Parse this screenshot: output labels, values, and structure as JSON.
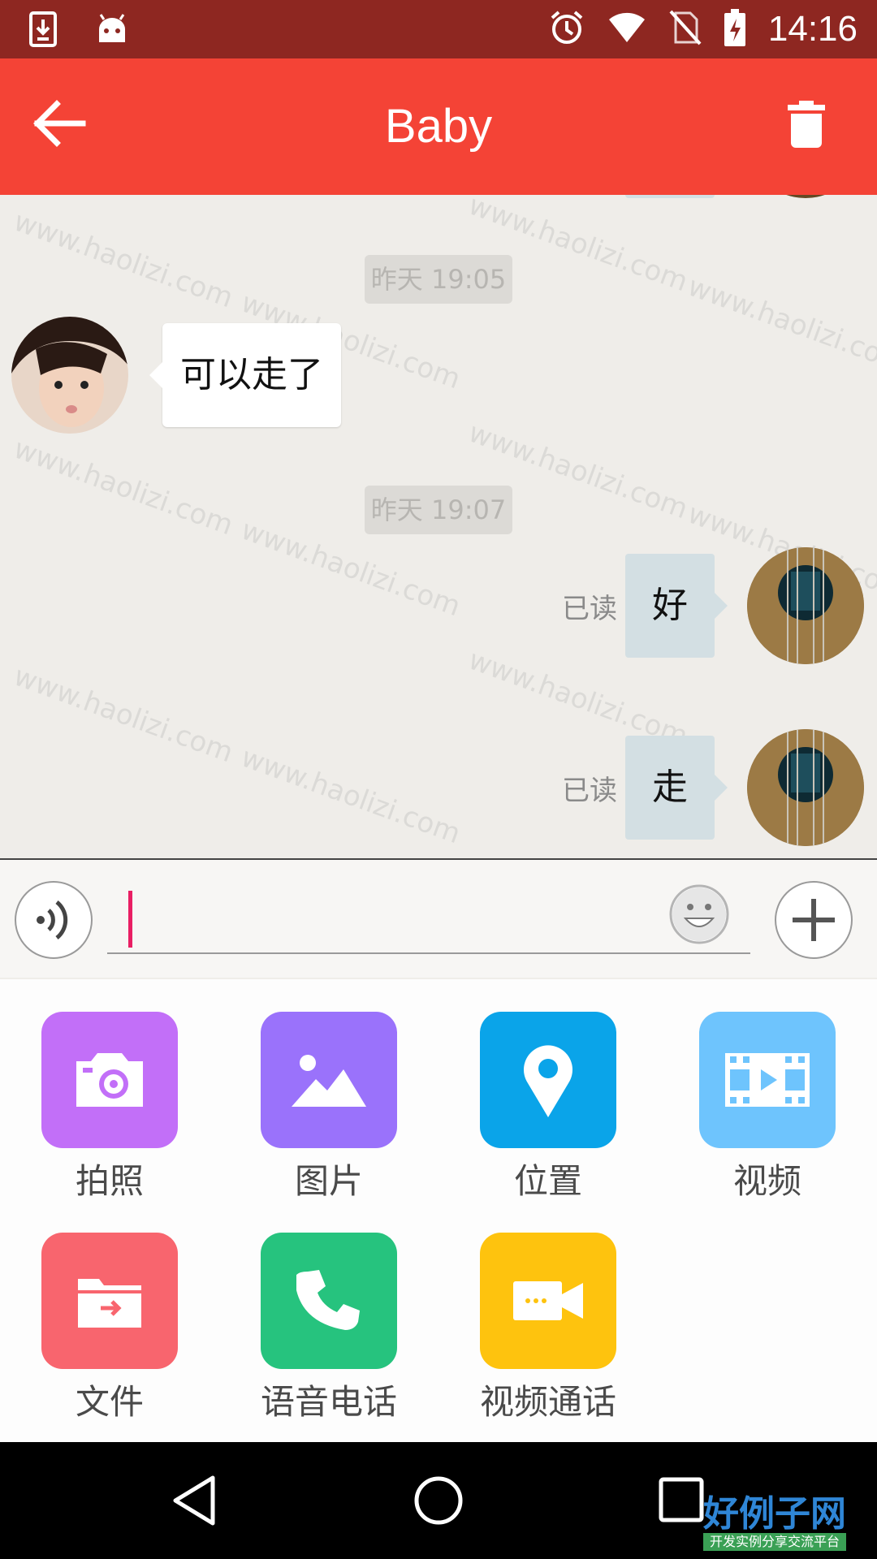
{
  "status_bar": {
    "time": "14:16",
    "icons": [
      "download-icon",
      "android-icon",
      "alarm-icon",
      "wifi-icon",
      "no-sim-icon",
      "battery-charging-icon"
    ]
  },
  "app_bar": {
    "title": "Baby",
    "left_icon": "back-arrow-icon",
    "right_icon": "trash-icon"
  },
  "chat": {
    "watermark": "www.haolizi.com",
    "timestamps": [
      "昨天 19:05",
      "昨天 19:07"
    ],
    "incoming": [
      {
        "text": "可以走了"
      }
    ],
    "outgoing": [
      {
        "text": "好",
        "status": "已读"
      },
      {
        "text": "走",
        "status": "已读"
      }
    ]
  },
  "input_bar": {
    "value": "",
    "voice_icon": "voice-icon",
    "emoji_icon": "emoji-icon",
    "plus_icon": "plus-icon"
  },
  "panel": {
    "items": [
      {
        "label": "拍照",
        "icon": "camera-icon",
        "color": "#c26ff8"
      },
      {
        "label": "图片",
        "icon": "image-icon",
        "color": "#9a72fb"
      },
      {
        "label": "位置",
        "icon": "location-icon",
        "color": "#0aa4e9"
      },
      {
        "label": "视频",
        "icon": "video-film-icon",
        "color": "#6ec4fd"
      },
      {
        "label": "文件",
        "icon": "folder-icon",
        "color": "#f8656e"
      },
      {
        "label": "语音电话",
        "icon": "phone-icon",
        "color": "#26c37e"
      },
      {
        "label": "视频通话",
        "icon": "video-call-icon",
        "color": "#fec30e"
      }
    ]
  },
  "nav_bar": {
    "buttons": [
      "back-triangle-icon",
      "home-circle-icon",
      "recents-square-icon"
    ],
    "logo_title": "好例子网",
    "logo_subtitle": "开发实例分享交流平台"
  },
  "colors": {
    "status_bar": "#8e2721",
    "app_bar": "#f44336",
    "chat_bg": "#efede9",
    "outgoing_bubble": "#d3dfe3",
    "caret": "#e91e63"
  }
}
